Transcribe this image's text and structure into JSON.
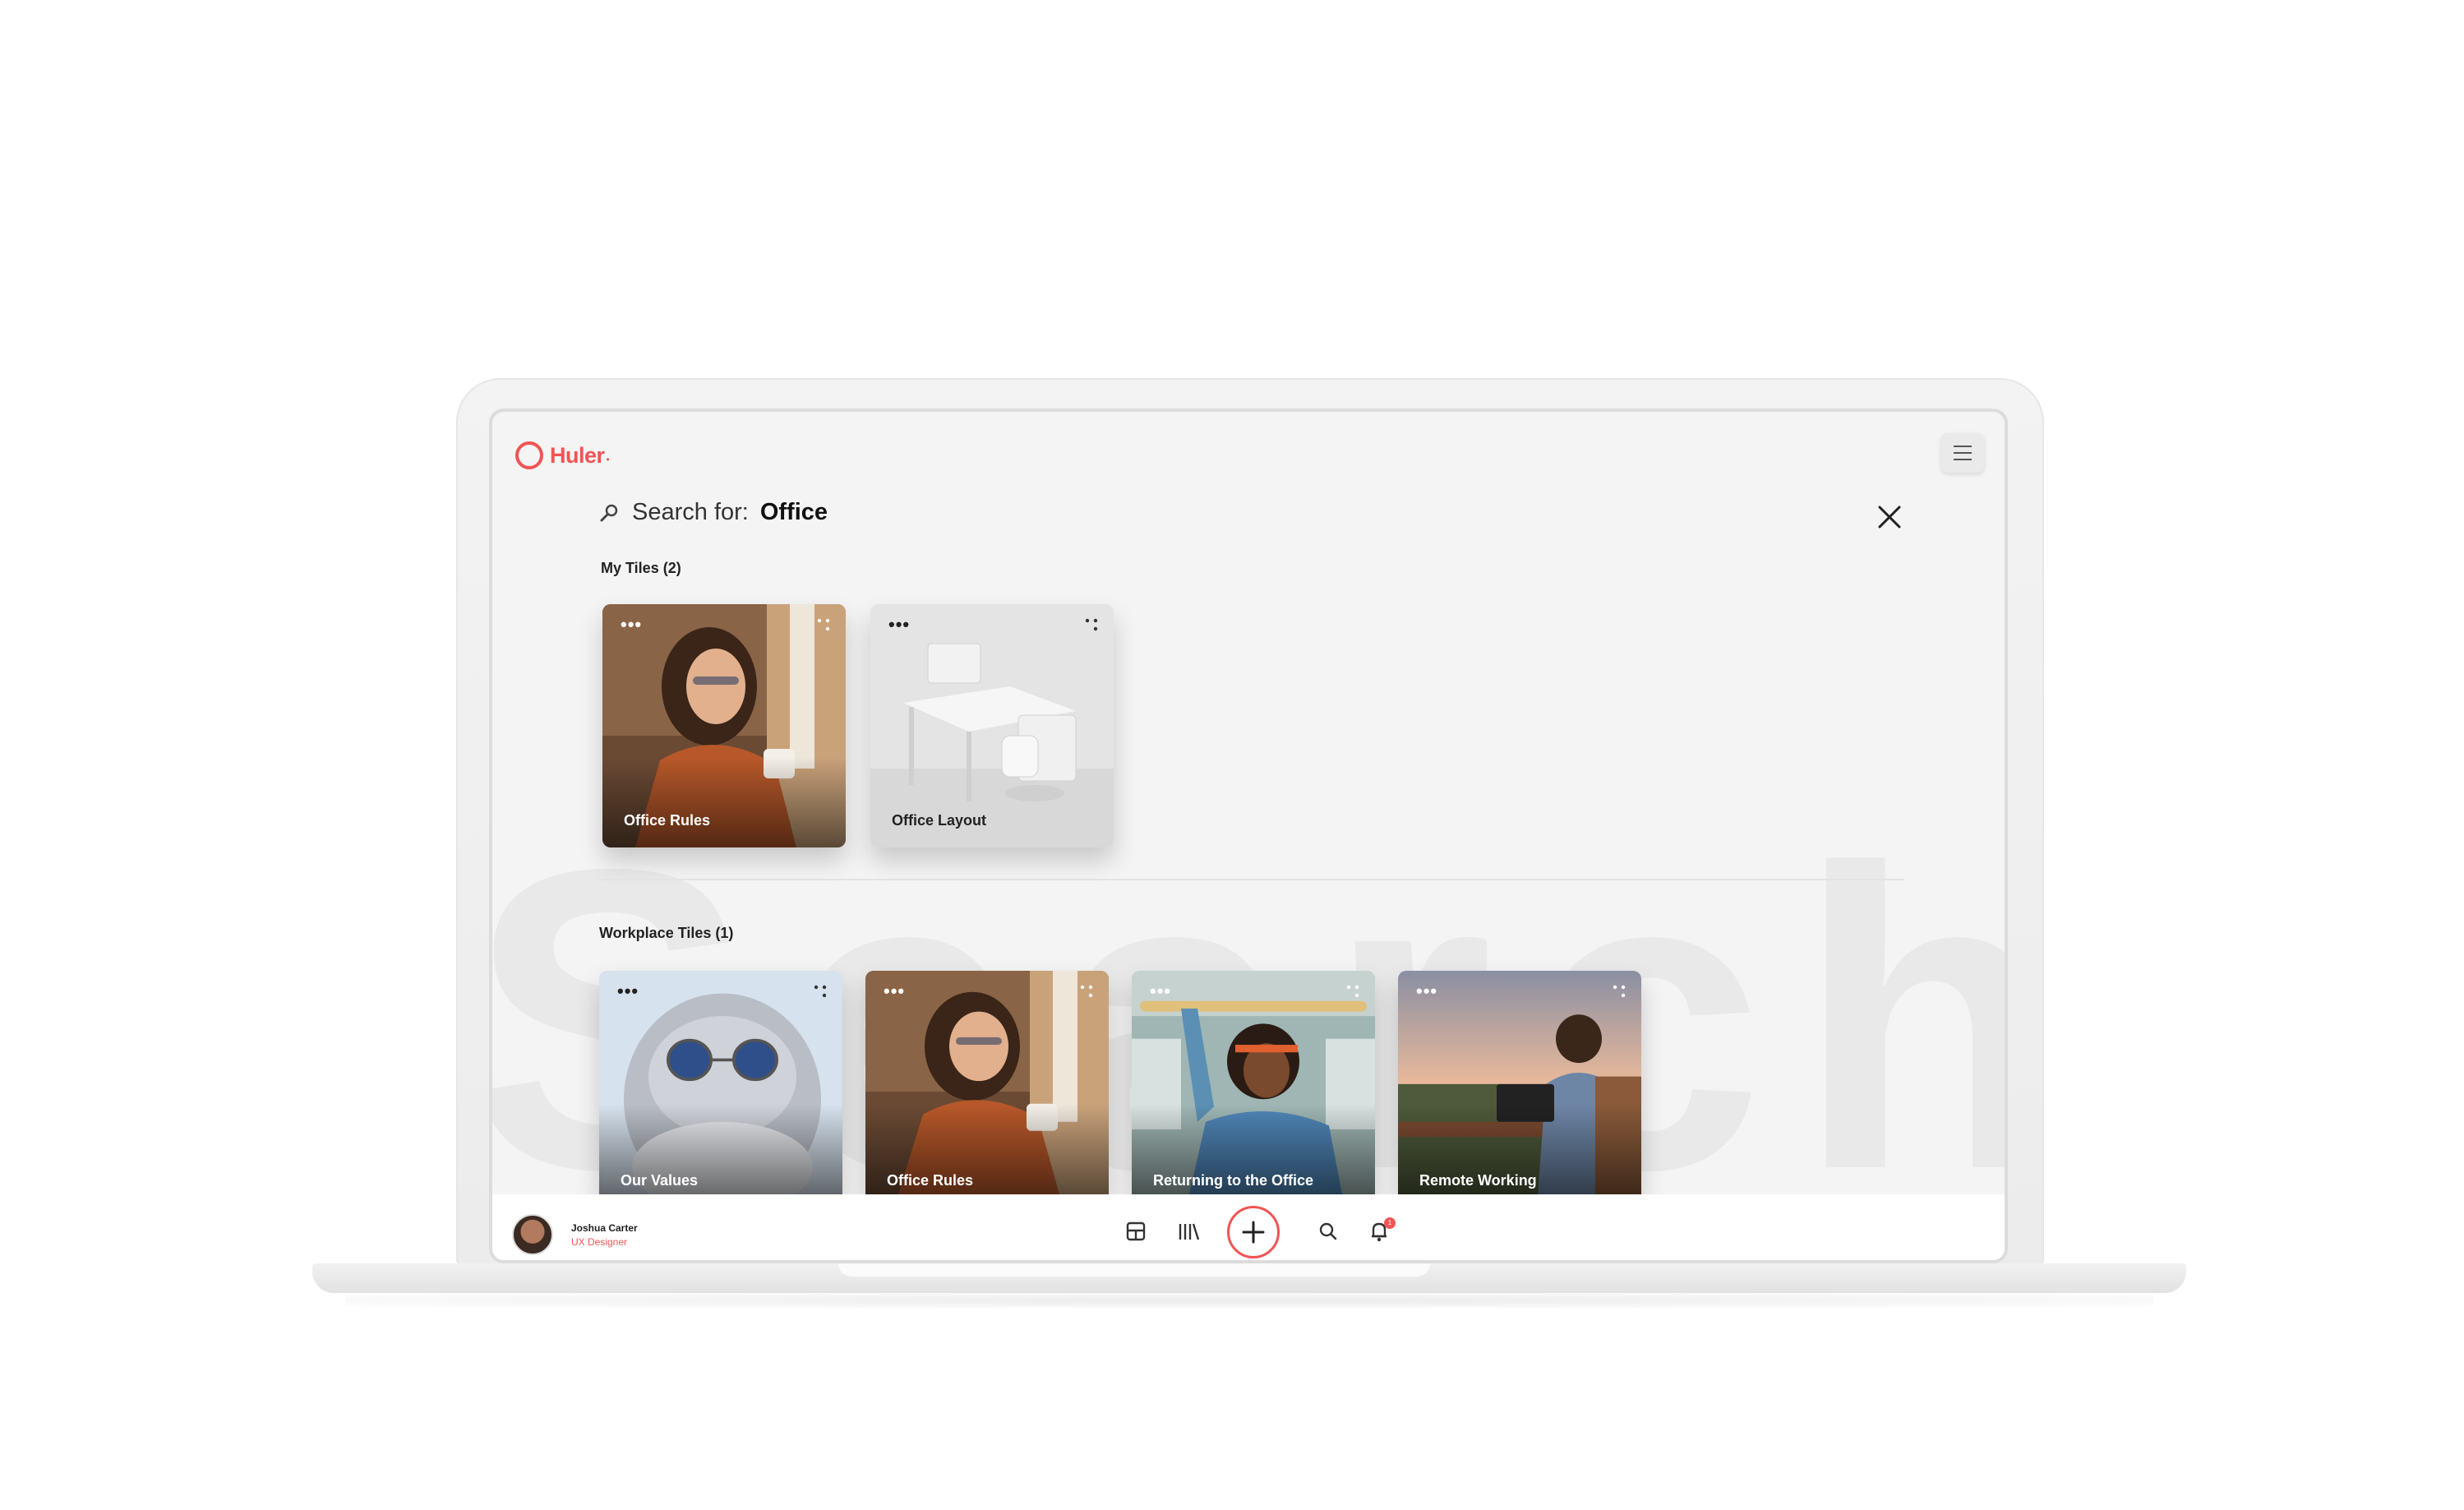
{
  "app": {
    "logo_text": "Huler"
  },
  "search": {
    "prefix": "Search for:",
    "term": "Office"
  },
  "watermark": "Search",
  "my_tiles": {
    "title": "My Tiles (2)",
    "tiles": [
      {
        "label": "Office Rules",
        "image": "woman-with-coffee"
      },
      {
        "label": "Office Layout",
        "image": "white-desk-chair"
      }
    ]
  },
  "workplace_tiles": {
    "title": "Workplace Tiles (1)",
    "tiles": [
      {
        "label": "Our Values",
        "image": "cat-with-sunglasses"
      },
      {
        "label": "Office Rules",
        "image": "woman-with-coffee"
      },
      {
        "label": "Returning to the Office",
        "image": "woman-on-train"
      },
      {
        "label": "Remote Working",
        "image": "woman-laptop-sunset"
      }
    ]
  },
  "tile_menu_glyph": "•••",
  "user": {
    "name": "Joshua Carter",
    "role": "UX Designer"
  },
  "notifications": {
    "count": "1"
  },
  "colors": {
    "accent": "#f05454",
    "background": "#f4f4f4",
    "bar": "#ffffff"
  },
  "icons": [
    "search-icon",
    "close-icon",
    "menu-icon",
    "dashboard-icon",
    "library-icon",
    "add-icon",
    "search-nav-icon",
    "bell-icon",
    "grip-icon"
  ]
}
